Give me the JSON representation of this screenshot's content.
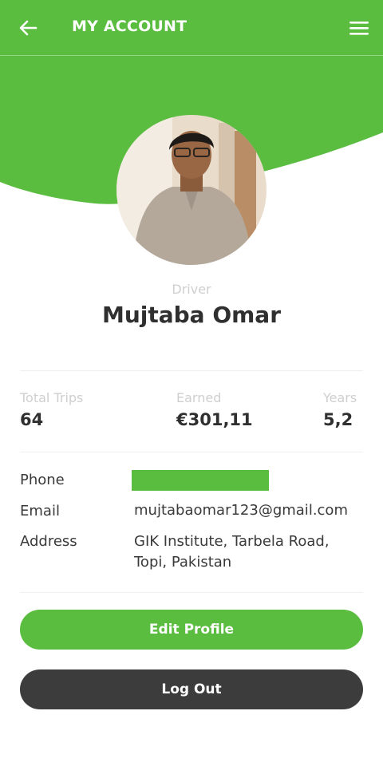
{
  "colors": {
    "primary": "#5abd40",
    "dark": "#3c3c3c",
    "muted": "#cfcfcf",
    "text": "#2f2f2f"
  },
  "header": {
    "title": "MY ACCOUNT",
    "back_icon": "arrow-left-icon",
    "menu_icon": "hamburger-menu-icon"
  },
  "profile": {
    "role": "Driver",
    "name": "Mujtaba Omar"
  },
  "stats": [
    {
      "label": "Total Trips",
      "value": "64"
    },
    {
      "label": "Earned",
      "value": "€301,11"
    },
    {
      "label": "Years",
      "value": "5,2"
    }
  ],
  "info": {
    "phone_label": "Phone",
    "email_label": "Email",
    "email_value": "mujtabaomar123@gmail.com",
    "address_label": "Address",
    "address_line1": "GIK Institute, Tarbela Road,",
    "address_line2": "Topi, Pakistan"
  },
  "actions": {
    "edit_label": "Edit Profile",
    "logout_label": "Log Out"
  }
}
